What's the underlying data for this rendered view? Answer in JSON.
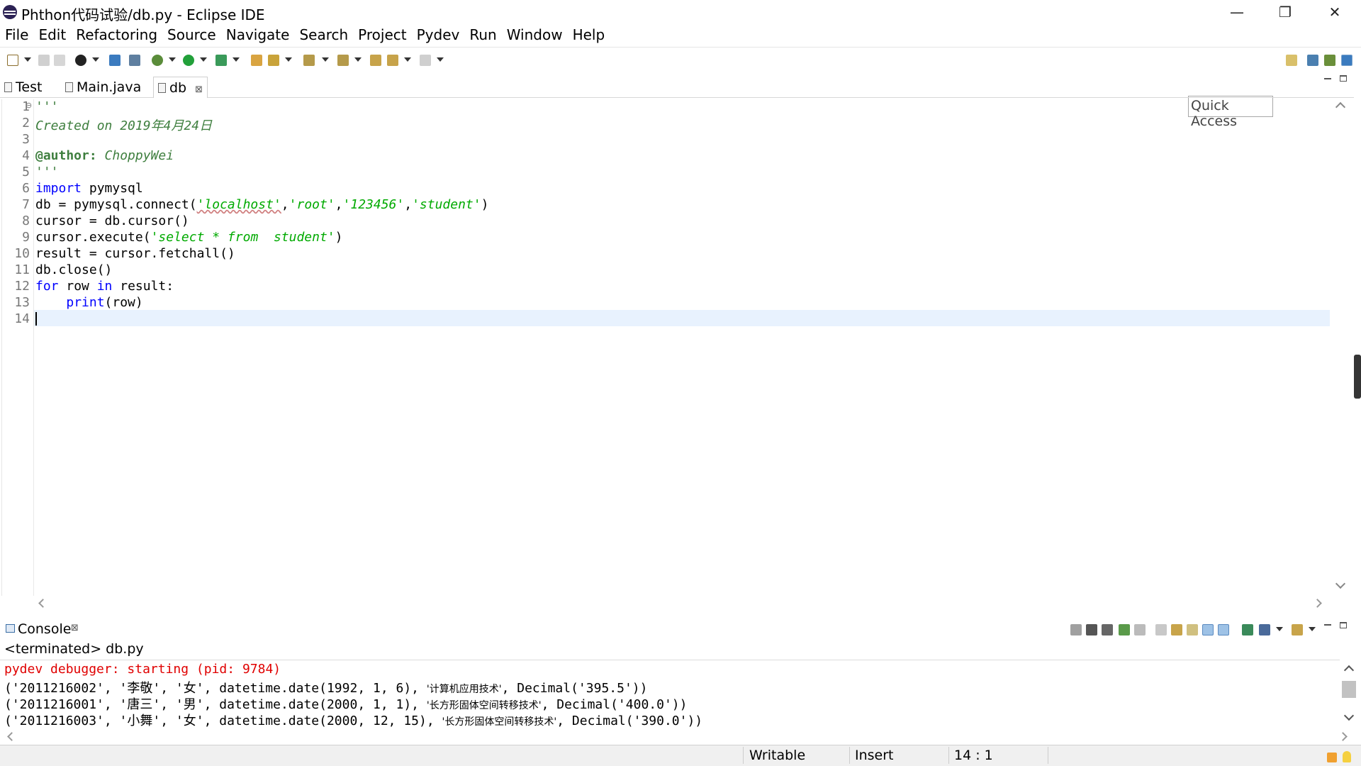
{
  "window": {
    "title": "Phthon代码试验/db.py - Eclipse IDE",
    "minimize": "—",
    "restore": "❐",
    "close": "✕"
  },
  "menu": [
    "File",
    "Edit",
    "Refactoring",
    "Source",
    "Navigate",
    "Search",
    "Project",
    "Pydev",
    "Run",
    "Window",
    "Help"
  ],
  "toolbar": {
    "quick_access": "Quick Access"
  },
  "tabs": [
    {
      "label": "Test"
    },
    {
      "label": "Main.java"
    },
    {
      "label": "db",
      "close": "⊠"
    }
  ],
  "editor": {
    "line_numbers": [
      "1",
      "2",
      "3",
      "4",
      "5",
      "6",
      "7",
      "8",
      "9",
      "10",
      "11",
      "12",
      "13",
      "14"
    ],
    "fold_marker": "⊖",
    "lines": {
      "l1": "'''",
      "l2": "Created on 2019年4月24日",
      "l4a": "@author:",
      "l4b": " ChoppyWei",
      "l5": "'''",
      "l6a": "import",
      "l6b": " pymysql",
      "l7a": "db = pymysql.connect(",
      "l7b": "'localhost'",
      "l7c": ",",
      "l7d": "'root'",
      "l7e": ",",
      "l7f": "'123456'",
      "l7g": ",",
      "l7h": "'student'",
      "l7i": ")",
      "l8": "cursor = db.cursor()",
      "l9a": "cursor.execute(",
      "l9b": "'select * from  student'",
      "l9c": ")",
      "l10": "result = cursor.fetchall()",
      "l11": "db.close()",
      "l12a": "for",
      "l12b": " row ",
      "l12c": "in",
      "l12d": " result:",
      "l13a": "    ",
      "l13b": "print",
      "l13c": "(row)"
    }
  },
  "console": {
    "tab_label": "Console",
    "tab_close": "⊠",
    "subtitle": "<terminated> db.py",
    "lines": {
      "c1": "pydev debugger: starting (pid: 9784)",
      "c2a": "('2011216002', '李敬', '女', datetime.date(1992, 1, 6), ",
      "c2b": "'计算机应用技术'",
      "c2c": ", Decimal('395.5'))",
      "c3a": "('2011216001', '唐三', '男', datetime.date(2000, 1, 1), ",
      "c3b": "'长方形固体空间转移技术'",
      "c3c": ", Decimal('400.0'))",
      "c4a": "('2011216003', '小舞', '女', datetime.date(2000, 12, 15), ",
      "c4b": "'长方形固体空间转移技术'",
      "c4c": ", Decimal('390.0'))"
    }
  },
  "status": {
    "writable": "Writable",
    "insert": "Insert",
    "position": "14 : 1"
  },
  "colors": {
    "comment": "#3f7f3f",
    "keyword": "#0000ff",
    "string": "#00aa00",
    "debugger": "#e00000",
    "current_line": "#e8f2fe"
  }
}
